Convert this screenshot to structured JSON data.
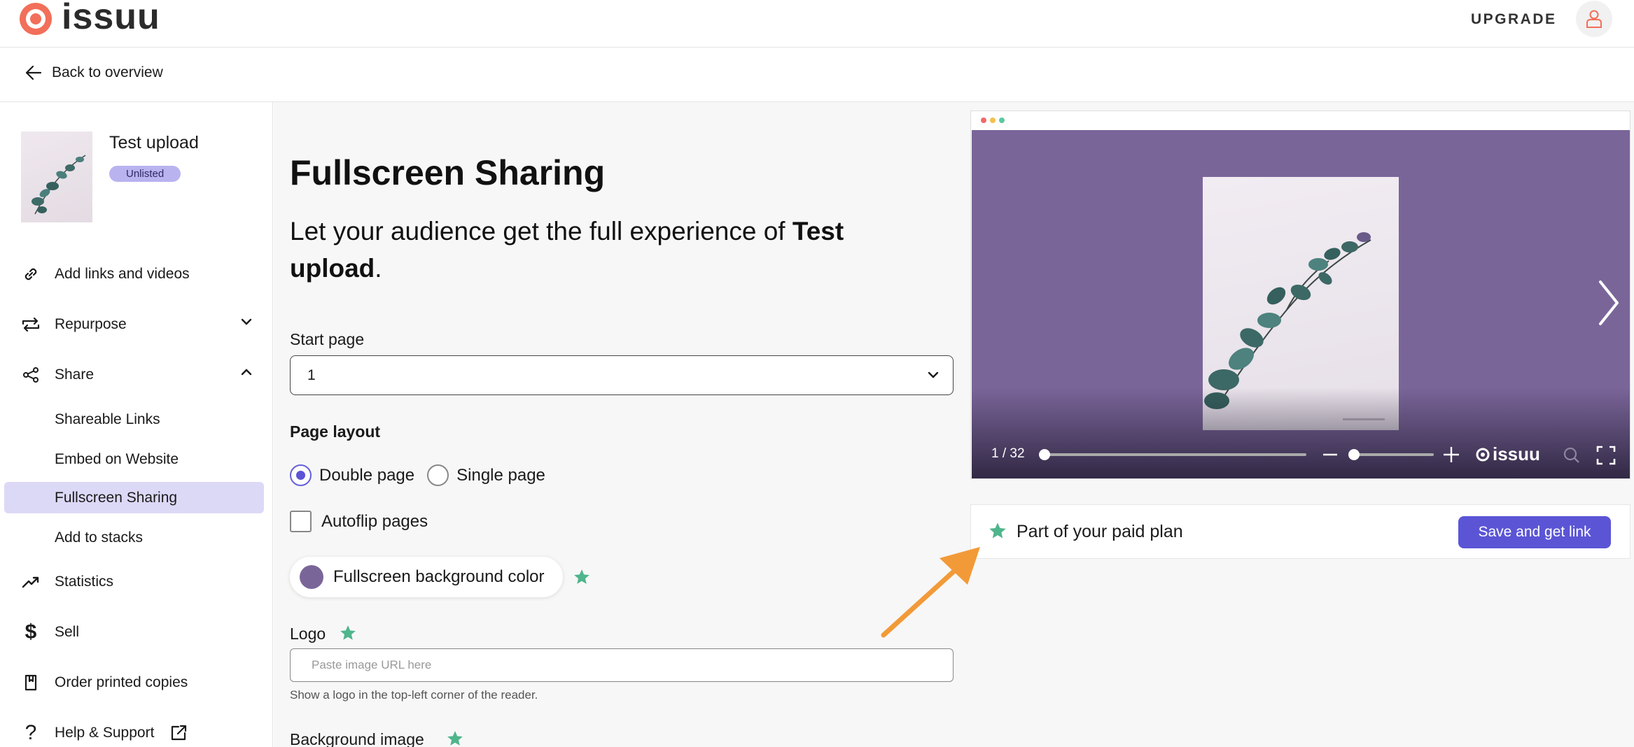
{
  "header": {
    "logo_text": "issuu",
    "upgrade_label": "UPGRADE"
  },
  "subheader": {
    "back_label": "Back to overview"
  },
  "sidebar": {
    "document": {
      "title": "Test upload",
      "status": "Unlisted"
    },
    "items": [
      {
        "label": "Add links and videos",
        "icon": "link-icon"
      },
      {
        "label": "Repurpose",
        "icon": "repeat-icon"
      },
      {
        "label": "Share",
        "icon": "share-icon"
      },
      {
        "label": "Statistics",
        "icon": "trend-icon"
      },
      {
        "label": "Sell",
        "icon": "dollar-icon"
      },
      {
        "label": "Order printed copies",
        "icon": "book-icon"
      },
      {
        "label": "Help & Support",
        "icon": "question-icon"
      }
    ],
    "share_sub_items": [
      {
        "label": "Shareable Links",
        "active": false
      },
      {
        "label": "Embed on Website",
        "active": false
      },
      {
        "label": "Fullscreen Sharing",
        "active": true
      },
      {
        "label": "Add to stacks",
        "active": false
      }
    ]
  },
  "main": {
    "title": "Fullscreen Sharing",
    "intro_prefix": "Let your audience get the full experience of ",
    "intro_doc": "Test upload",
    "intro_suffix": ".",
    "start_page_label": "Start page",
    "start_page_value": "1",
    "page_layout_label": "Page layout",
    "layout_options": [
      "Double page",
      "Single page"
    ],
    "layout_selected": "Double page",
    "autoflip_label": "Autoflip pages",
    "autoflip_checked": false,
    "bg_color_label": "Fullscreen background color",
    "bg_color_value": "#7a6599",
    "logo_label": "Logo",
    "logo_placeholder": "Paste image URL here",
    "logo_hint": "Show a logo in the top-left corner of the reader.",
    "bg_image_label": "Background image"
  },
  "preview": {
    "page_indicator": "1 / 32",
    "reader_logo": "issuu",
    "progress": 0.0
  },
  "paid_bar": {
    "text": "Part of your paid plan",
    "save_label": "Save and get link"
  },
  "colors": {
    "accent": "#5b55d6",
    "star": "#4fb58c",
    "brand": "#f26f5a",
    "annotation_arrow": "#f29a38"
  }
}
